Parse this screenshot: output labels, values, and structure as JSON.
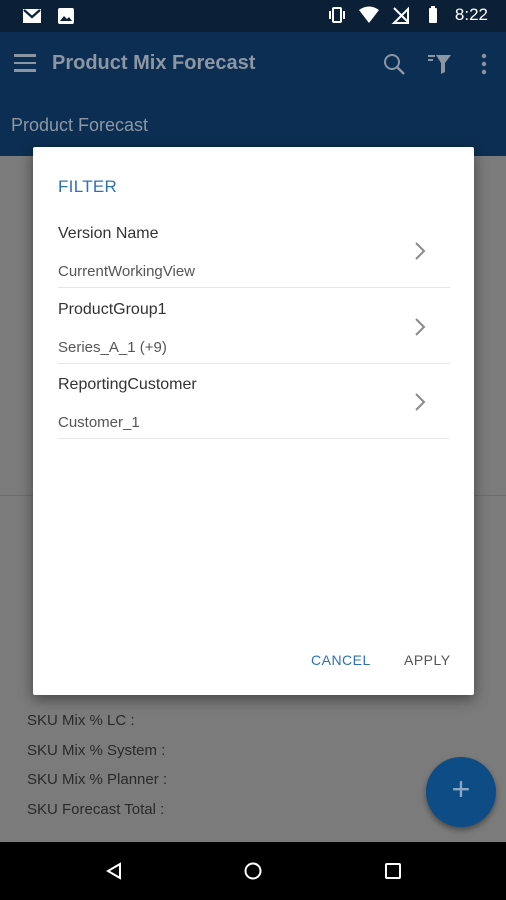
{
  "status_bar": {
    "time": "8:22",
    "left_icons": [
      "gmail-icon",
      "image-icon"
    ],
    "right_icons": [
      "vibrate-icon",
      "wifi-icon",
      "no-signal-icon",
      "battery-icon"
    ]
  },
  "app_bar": {
    "title": "Product Mix Forecast",
    "icons": [
      "menu-icon",
      "search-icon",
      "filter-icon",
      "more-vert-icon"
    ]
  },
  "sub_header": {
    "title": "Product Forecast"
  },
  "background_list": [
    "SKU Mix % LC :",
    "SKU Mix % System :",
    "SKU Mix % Planner :",
    "SKU Forecast Total :"
  ],
  "dialog": {
    "title": "FILTER",
    "rows": [
      {
        "label": "Version Name",
        "value": "CurrentWorkingView"
      },
      {
        "label": "ProductGroup1",
        "value": "Series_A_1 (+9)"
      },
      {
        "label": "ReportingCustomer",
        "value": "Customer_1"
      }
    ],
    "cancel_label": "CANCEL",
    "apply_label": "APPLY"
  },
  "fab": {
    "label": "+"
  },
  "colors": {
    "accent": "#2c72b8",
    "app_bar": "#0c2e52",
    "status_bar": "#0b2037",
    "fab": "#0e4c86",
    "scrim": "#7b7b7b"
  }
}
